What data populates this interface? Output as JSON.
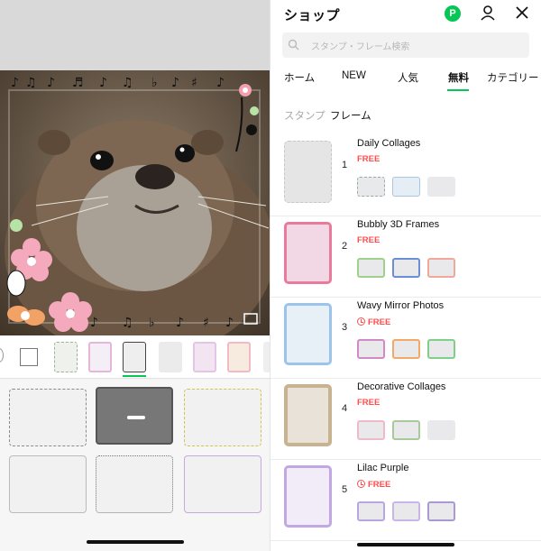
{
  "shop": {
    "title": "ショップ",
    "badge": "P",
    "search_placeholder": "スタンプ・フレーム検索",
    "tabs": [
      {
        "label": "ホーム"
      },
      {
        "label": "NEW"
      },
      {
        "label": "人気"
      },
      {
        "label": "無料"
      },
      {
        "label": "カテゴリー"
      }
    ],
    "active_tab": "無料",
    "subtabs": [
      {
        "label": "スタンプ"
      },
      {
        "label": "フレーム"
      }
    ],
    "active_subtab": "フレーム",
    "items": [
      {
        "rank": "1",
        "name": "Daily Collages",
        "price": "FREE",
        "limited": false
      },
      {
        "rank": "2",
        "name": "Bubbly 3D Frames",
        "price": "FREE",
        "limited": false
      },
      {
        "rank": "3",
        "name": "Wavy Mirror Photos",
        "price": "FREE",
        "limited": true
      },
      {
        "rank": "4",
        "name": "Decorative Collages",
        "price": "FREE",
        "limited": false
      },
      {
        "rank": "5",
        "name": "Lilac Purple",
        "price": "FREE",
        "limited": true
      }
    ]
  },
  "editor": {
    "icons": [
      "frame-rotate-icon",
      "no-frame-icon"
    ]
  },
  "colors": {
    "accent": "#06c755",
    "free": "#ff4d4d",
    "muted": "#aaaaaa"
  }
}
